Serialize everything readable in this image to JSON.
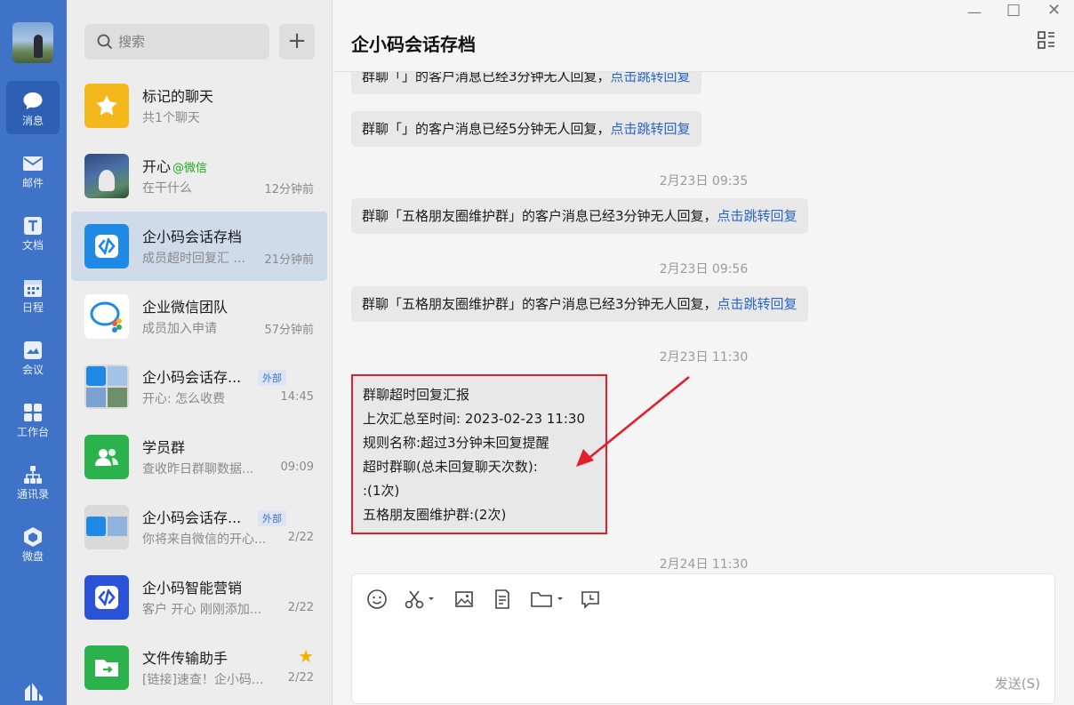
{
  "nav": {
    "items": [
      {
        "label": "消息",
        "icon": "message-icon"
      },
      {
        "label": "邮件",
        "icon": "mail-icon"
      },
      {
        "label": "文档",
        "icon": "document-icon"
      },
      {
        "label": "日程",
        "icon": "calendar-icon"
      },
      {
        "label": "会议",
        "icon": "meeting-icon"
      },
      {
        "label": "工作台",
        "icon": "workbench-icon"
      },
      {
        "label": "通讯录",
        "icon": "contacts-icon"
      },
      {
        "label": "微盘",
        "icon": "cloud-disk-icon"
      }
    ]
  },
  "search": {
    "placeholder": "搜索"
  },
  "conversations": [
    {
      "name": "标记的聊天",
      "sub": "共1个聊天",
      "time": ""
    },
    {
      "name": "开心",
      "wechat": "@微信",
      "sub": "在干什么",
      "time": "12分钟前"
    },
    {
      "name": "企小码会话存档",
      "sub": "成员超时回复汇 ...",
      "time": "21分钟前"
    },
    {
      "name": "企业微信团队",
      "sub": "成员加入申请",
      "time": "57分钟前"
    },
    {
      "name": "企小码会话存...",
      "tag": "外部",
      "sub": "开心: 怎么收费",
      "time": "14:45"
    },
    {
      "name": "学员群",
      "sub": "查收昨日群聊数据...",
      "time": "09:09"
    },
    {
      "name": "企小码会话存...",
      "tag": "外部",
      "sub": "你将来自微信的开心...",
      "time": "2/22"
    },
    {
      "name": "企小码智能营销",
      "sub": "客户 开心 刚刚添加...",
      "time": "2/22"
    },
    {
      "name": "文件传输助手",
      "sub": "[链接]速查！企小码...",
      "time": "2/22"
    }
  ],
  "chat": {
    "title": "企小码会话存档",
    "messages": [
      {
        "text": "群聊「」的客户消息已经3分钟无人回复，",
        "link": "点击跳转回复"
      },
      {
        "text": "群聊「」的客户消息已经5分钟无人回复，",
        "link": "点击跳转回复"
      },
      {
        "time": "2月23日 09:35"
      },
      {
        "text": "群聊「五格朋友圈维护群」的客户消息已经3分钟无人回复，",
        "link": "点击跳转回复"
      },
      {
        "time": "2月23日 09:56"
      },
      {
        "text": "群聊「五格朋友圈维护群」的客户消息已经3分钟无人回复，",
        "link": "点击跳转回复"
      },
      {
        "time": "2月23日 11:30"
      },
      {
        "time": "2月24日 11:30"
      }
    ],
    "report": [
      "群聊超时回复汇报",
      "上次汇总至时间: 2023-02-23 11:30",
      "规则名称:超过3分钟未回复提醒",
      "超时群聊(总未回复聊天次数):",
      ":(1次)",
      "五格朋友圈维护群:(2次)"
    ],
    "send_label": "发送(S)"
  },
  "colors": {
    "nav": "#3f73c8",
    "nav_active": "#2d60b5",
    "link": "#2a66c9",
    "highlight": "#e0202a"
  }
}
